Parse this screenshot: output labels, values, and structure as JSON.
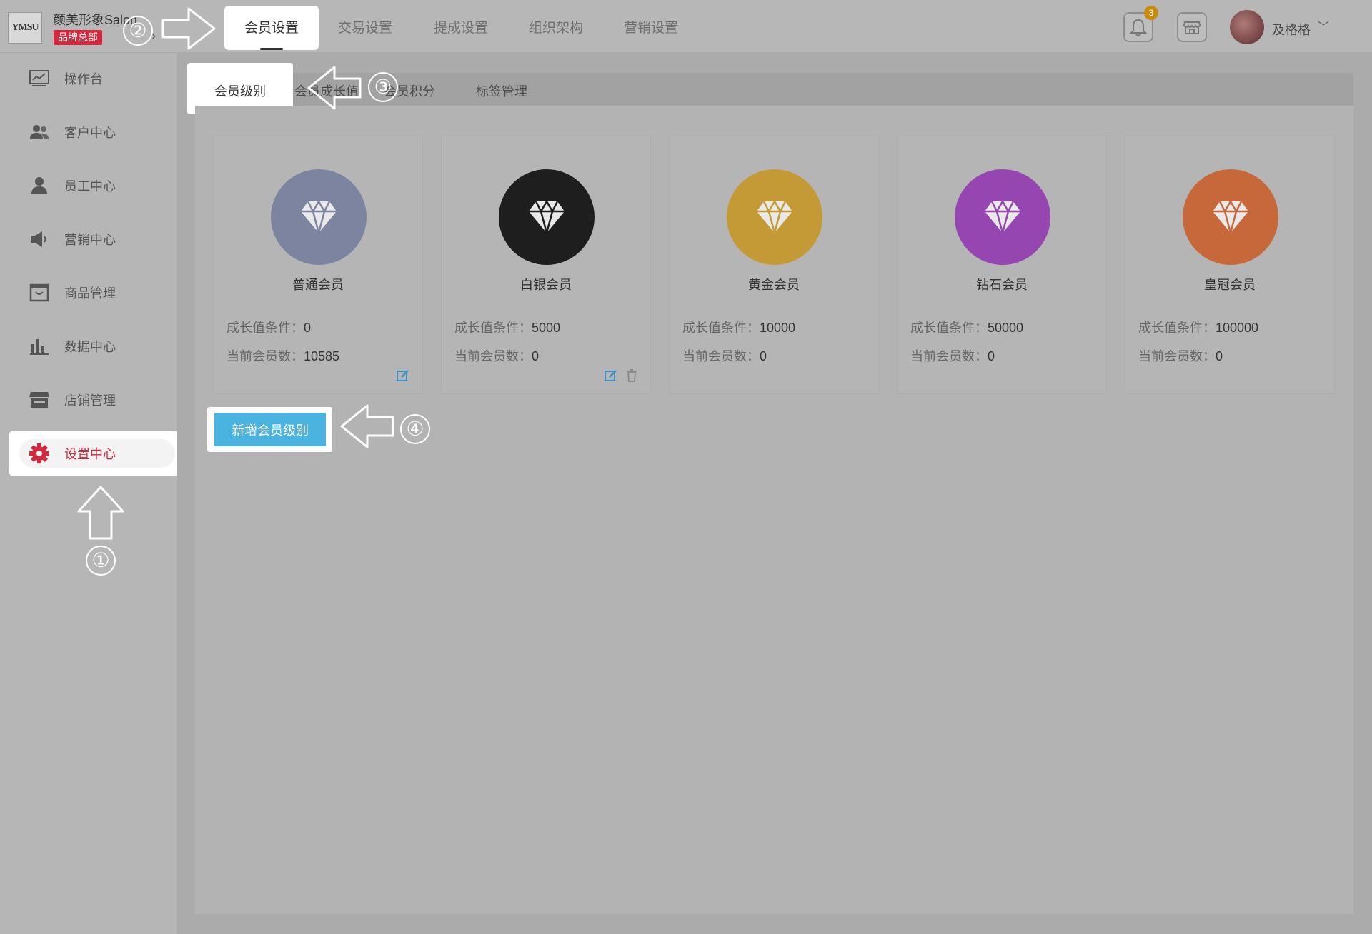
{
  "brand": {
    "logo_text": "YMSU",
    "name": "颜美形象Salon",
    "badge": "品牌总部"
  },
  "top_nav": {
    "items": [
      "会员设置",
      "交易设置",
      "提成设置",
      "组织架构",
      "营销设置"
    ],
    "active": "会员设置"
  },
  "header": {
    "notification_count": "3",
    "username": "及格格"
  },
  "sidebar": {
    "items": [
      {
        "label": "操作台",
        "icon": "dashboard-icon"
      },
      {
        "label": "客户中心",
        "icon": "customers-icon"
      },
      {
        "label": "员工中心",
        "icon": "staff-icon"
      },
      {
        "label": "营销中心",
        "icon": "megaphone-icon"
      },
      {
        "label": "商品管理",
        "icon": "box-icon"
      },
      {
        "label": "数据中心",
        "icon": "bar-chart-icon"
      },
      {
        "label": "店铺管理",
        "icon": "store-icon"
      },
      {
        "label": "设置中心",
        "icon": "gear-icon"
      }
    ],
    "active": "设置中心"
  },
  "tabs": {
    "items": [
      "会员级别",
      "会员成长值",
      "会员积分",
      "标签管理"
    ],
    "active": "会员级别"
  },
  "levels": [
    {
      "name": "普通会员",
      "growth_label": "成长值条件：",
      "growth": "0",
      "count_label": "当前会员数：",
      "count": "10585",
      "color": "#7c849f",
      "editable": true,
      "deletable": false
    },
    {
      "name": "白银会员",
      "growth_label": "成长值条件：",
      "growth": "5000",
      "count_label": "当前会员数：",
      "count": "0",
      "color": "#1e1e1e",
      "editable": true,
      "deletable": true
    },
    {
      "name": "黄金会员",
      "growth_label": "成长值条件：",
      "growth": "10000",
      "count_label": "当前会员数：",
      "count": "0",
      "color": "#c39a35",
      "editable": false,
      "deletable": false
    },
    {
      "name": "钻石会员",
      "growth_label": "成长值条件：",
      "growth": "50000",
      "count_label": "当前会员数：",
      "count": "0",
      "color": "#9646b0",
      "editable": false,
      "deletable": false
    },
    {
      "name": "皇冠会员",
      "growth_label": "成长值条件：",
      "growth": "100000",
      "count_label": "当前会员数：",
      "count": "0",
      "color": "#c7683b",
      "editable": false,
      "deletable": false
    }
  ],
  "add_button": "新增会员级别",
  "steps": [
    "①",
    "②",
    "③",
    "④"
  ],
  "colors": {
    "brand_red": "#d3293f",
    "accent_blue": "#4ab3e0",
    "active_red": "#d3293f"
  }
}
